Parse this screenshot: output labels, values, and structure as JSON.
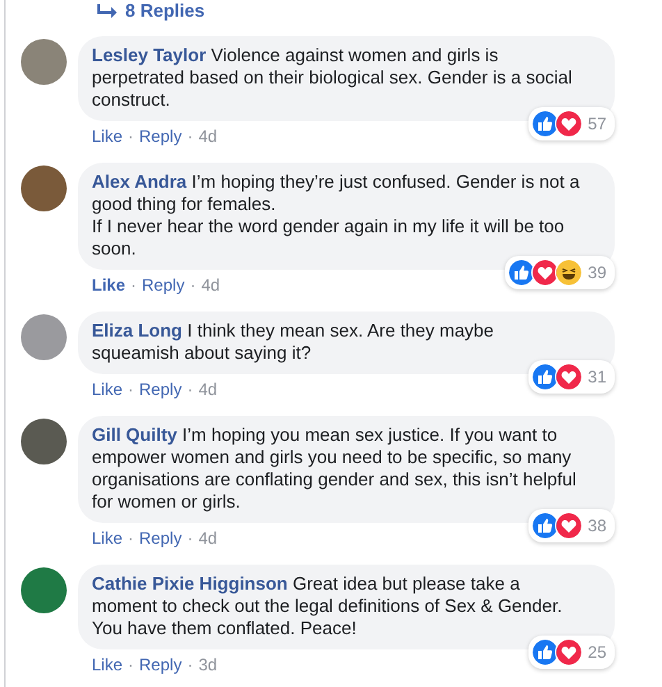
{
  "replies_link": {
    "label": "8 Replies"
  },
  "comments": [
    {
      "author": "Lesley Taylor",
      "text": "Violence against women and girls is perpetrated based on their biological sex. Gender is a social construct.",
      "reactions": [
        {
          "kind": "like"
        },
        {
          "kind": "love"
        }
      ],
      "reaction_count": "57",
      "like": {
        "label": "Like",
        "selected": false
      },
      "separators": [
        "·",
        "·"
      ],
      "reply": "Reply",
      "time": "4d"
    },
    {
      "author": "Alex Andra",
      "text": "I’m hoping they’re just confused. Gender is not a good thing for females.\nIf I never hear the word gender again in my life it will be too soon.",
      "reactions": [
        {
          "kind": "like"
        },
        {
          "kind": "love"
        },
        {
          "kind": "haha"
        }
      ],
      "reaction_count": "39",
      "like": {
        "label": "Like",
        "selected": true
      },
      "separators": [
        "·",
        "·"
      ],
      "reply": "Reply",
      "time": "4d"
    },
    {
      "author": "Eliza Long",
      "text": "I think they mean sex. Are they maybe squeamish about saying it?",
      "reactions": [
        {
          "kind": "like"
        },
        {
          "kind": "love"
        }
      ],
      "reaction_count": "31",
      "like": {
        "label": "Like",
        "selected": false
      },
      "separators": [
        "·",
        "·"
      ],
      "reply": "Reply",
      "time": "4d"
    },
    {
      "author": "Gill Quilty",
      "text": "I’m hoping you mean sex justice. If you want to empower women and girls you need to be specific, so many organisations are conflating gender and sex, this isn’t helpful for women or girls.",
      "reactions": [
        {
          "kind": "like"
        },
        {
          "kind": "love"
        }
      ],
      "reaction_count": "38",
      "like": {
        "label": "Like",
        "selected": false
      },
      "separators": [
        "·",
        "·"
      ],
      "reply": "Reply",
      "time": "4d"
    },
    {
      "author": "Cathie Pixie Higginson",
      "text": "Great idea but please take a moment to check out the legal definitions of Sex & Gender. You have them conflated. Peace!",
      "reactions": [
        {
          "kind": "like"
        },
        {
          "kind": "love"
        }
      ],
      "reaction_count": "25",
      "like": {
        "label": "Like",
        "selected": false
      },
      "separators": [
        "·",
        "·"
      ],
      "reply": "Reply",
      "time": "3d"
    }
  ]
}
